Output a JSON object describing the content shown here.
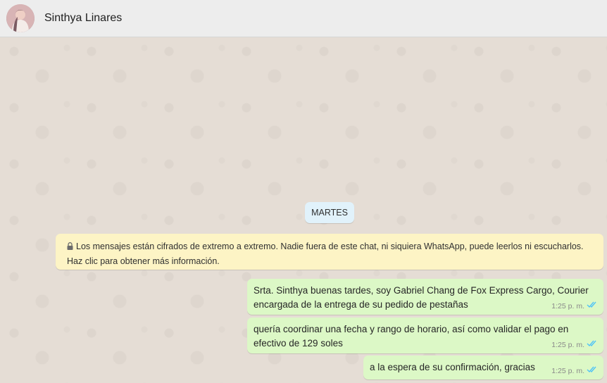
{
  "header": {
    "contact_name": "Sinthya Linares"
  },
  "date_chip": "MARTES",
  "encryption_notice": {
    "text": "Los mensajes están cifrados de extremo a extremo. Nadie fuera de este chat, ni siquiera WhatsApp, puede leerlos ni escucharlos. Haz clic para obtener más información.",
    "icon": "lock-icon"
  },
  "messages": [
    {
      "text": "Srta. Sinthya buenas tardes, soy Gabriel Chang de Fox Express Cargo, Courier encargada de la entrega de su pedido de pestañas",
      "time": "1:25 p. m.",
      "status_icon": "double-check-icon"
    },
    {
      "text": "quería coordinar una fecha y rango de horario, así como validar el pago en efectivo de 129 soles",
      "time": "1:25 p. m.",
      "status_icon": "double-check-icon"
    },
    {
      "text": "a la espera de su confirmación, gracias",
      "time": "1:25 p. m.",
      "status_icon": "double-check-icon"
    }
  ],
  "colors": {
    "outgoing_bubble": "#dcf8c6",
    "notice_bubble": "#fdf4c5",
    "date_chip": "#e1f2fb",
    "read_check": "#4fc3f7",
    "chat_background": "#e5ddd5",
    "header_background": "#ededed"
  }
}
